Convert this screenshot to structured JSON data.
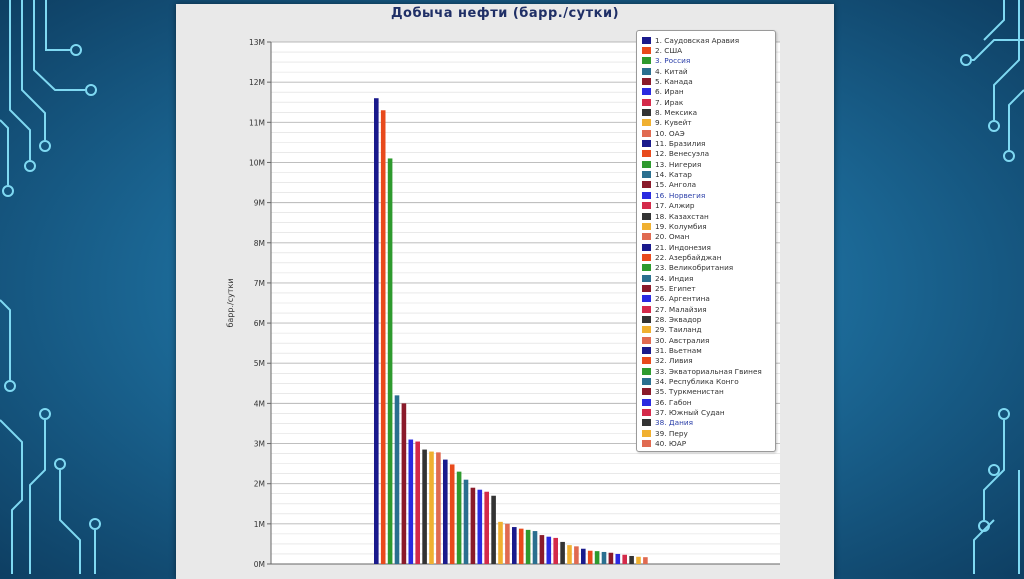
{
  "slide": {
    "background": "#1c6a98"
  },
  "chart_data": {
    "type": "bar",
    "title": "Добыча нефти (барр./сутки)",
    "xlabel": "",
    "ylabel": "барр./сутки",
    "ylim": [
      0,
      13000000
    ],
    "ytick_values": [
      0,
      1000000,
      2000000,
      3000000,
      4000000,
      5000000,
      6000000,
      7000000,
      8000000,
      9000000,
      10000000,
      11000000,
      12000000,
      13000000
    ],
    "ytick_labels": [
      "0M",
      "1M",
      "2M",
      "3M",
      "4M",
      "5M",
      "6M",
      "7M",
      "8M",
      "9M",
      "10M",
      "11M",
      "12M",
      "13M"
    ],
    "grid": true,
    "legend_position": "top-right",
    "categories": [
      "1. Саудовская Аравия",
      "2. США",
      "3. Россия",
      "4. Китай",
      "5. Канада",
      "6. Иран",
      "7. Ирак",
      "8. Мексика",
      "9. Кувейт",
      "10. ОАЭ",
      "11. Бразилия",
      "12. Венесуэла",
      "13. Нигерия",
      "14. Катар",
      "15. Ангола",
      "16. Норвегия",
      "17. Алжир",
      "18. Казахстан",
      "19. Колумбия",
      "20. Оман",
      "21. Индонезия",
      "22. Азербайджан",
      "23. Великобритания",
      "24. Индия",
      "25. Египет",
      "26. Аргентина",
      "27. Малайзия",
      "28. Эквадор",
      "29. Таиланд",
      "30. Австралия",
      "31. Вьетнам",
      "32. Ливия",
      "33. Экваториальная Гвинея",
      "34. Республика Конго",
      "35. Туркменистан",
      "36. Габон",
      "37. Южный Судан",
      "38. Дания",
      "39. Перу",
      "40. ЮАР"
    ],
    "values": [
      11600000,
      11300000,
      10100000,
      4200000,
      4000000,
      3100000,
      3050000,
      2850000,
      2800000,
      2780000,
      2600000,
      2480000,
      2300000,
      2100000,
      1900000,
      1850000,
      1800000,
      1700000,
      1050000,
      1000000,
      920000,
      880000,
      850000,
      820000,
      720000,
      680000,
      650000,
      550000,
      470000,
      440000,
      380000,
      330000,
      320000,
      300000,
      280000,
      250000,
      230000,
      200000,
      180000,
      170000
    ],
    "colors": [
      "#1a1a8c",
      "#e84a1c",
      "#2e9a2e",
      "#2a6f8f",
      "#8a1a2a",
      "#2a2ae0",
      "#d42a4a",
      "#333333",
      "#f0b030",
      "#e06a50",
      "#1a1a8c",
      "#e84a1c",
      "#2e9a2e",
      "#2a6f8f",
      "#8a1a2a",
      "#2a2ae0",
      "#d42a4a",
      "#333333",
      "#f0b030",
      "#e06a50",
      "#1a1a8c",
      "#e84a1c",
      "#2e9a2e",
      "#2a6f8f",
      "#8a1a2a",
      "#2a2ae0",
      "#d42a4a",
      "#333333",
      "#f0b030",
      "#e06a50",
      "#1a1a8c",
      "#e84a1c",
      "#2e9a2e",
      "#2a6f8f",
      "#8a1a2a",
      "#2a2ae0",
      "#d42a4a",
      "#333333",
      "#f0b030",
      "#e06a50"
    ],
    "legend_highlight": [
      "3. Россия",
      "16. Норвегия",
      "38. Дания"
    ]
  }
}
